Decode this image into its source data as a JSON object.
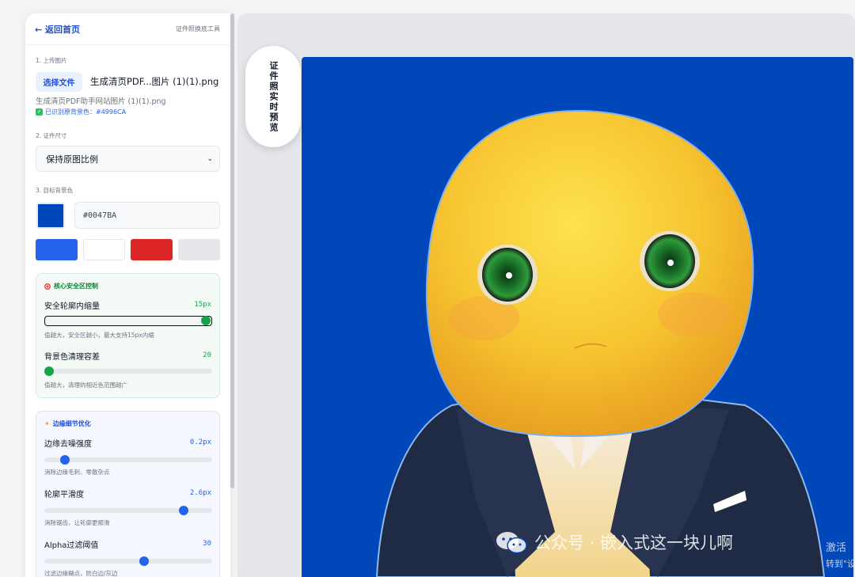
{
  "header": {
    "back_label": "← 返回首页",
    "tool_name": "证件照换底工具"
  },
  "upload": {
    "section_label": "1. 上传图片",
    "button_label": "选择文件",
    "chosen_display": "生成清页PDF...图片 (1)(1).png",
    "file_name": "生成清页PDF助手网站图片 (1)(1).png",
    "detected_text": "已识别原背景色：#4996CA"
  },
  "size": {
    "section_label": "2. 证件尺寸",
    "selected": "保持原图比例"
  },
  "background": {
    "section_label": "3. 目标背景色",
    "current_hex": "#0047BA",
    "current_color": "#0047BA",
    "presets": [
      {
        "name": "blue",
        "color": "#2563EB"
      },
      {
        "name": "white",
        "color": "#FFFFFF"
      },
      {
        "name": "red",
        "color": "#DC2626"
      },
      {
        "name": "gray",
        "color": "#E5E7EB"
      }
    ]
  },
  "safe_zone": {
    "title": "核心安全区控制",
    "controls": [
      {
        "label": "安全轮廓内缩量",
        "value_text": "15px",
        "fraction": 1.0,
        "hint": "值越大，安全区越小，最大支持15px内缩"
      },
      {
        "label": "背景色清理容差",
        "value_text": "20",
        "fraction": 0.0,
        "hint": "值越大，清理的相近色范围越广"
      }
    ],
    "accent": "#16A34A"
  },
  "edge": {
    "title": "边缘细节优化",
    "controls": [
      {
        "label": "边缘去噪强度",
        "value_text": "0.2px",
        "fraction": 0.1,
        "hint": "消除边缘毛刺、零散杂点"
      },
      {
        "label": "轮廓平滑度",
        "value_text": "2.6px",
        "fraction": 0.85,
        "hint": "消除锯齿，让轮廓更顺滑"
      },
      {
        "label": "Alpha过滤阈值",
        "value_text": "30",
        "fraction": 0.6,
        "hint": "过滤边缘糊点，防白边/灰边"
      }
    ],
    "accent": "#2563EB"
  },
  "preview": {
    "bubble_label": "证件照实时预览",
    "background_color": "#0047BA"
  },
  "watermark": {
    "text": "公众号 · 嵌入式这一块儿啊"
  },
  "os_notice": {
    "line1": "激活",
    "line2": "转到\"设"
  }
}
